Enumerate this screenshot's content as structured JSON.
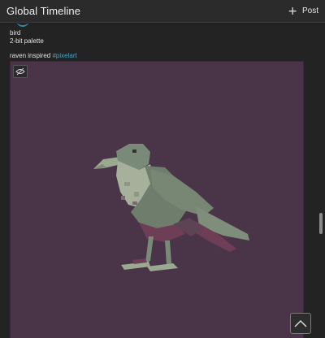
{
  "header": {
    "title": "Global Timeline",
    "post_label": "Post"
  },
  "post": {
    "line1": "bird",
    "line2": "2-bit palette",
    "desc_text": "raven inspired ",
    "hashtag": "#pixelart"
  },
  "colors": {
    "image_bg": "#4a3447",
    "bird_light": "#9aaa91",
    "bird_mid": "#6f7d6c",
    "bird_dark": "#6e3e56",
    "hashtag": "#4aa3c4"
  },
  "icons": {
    "post": "plus-icon",
    "sensitive": "eye-off-icon",
    "scroll_top": "chevron-up-icon"
  }
}
